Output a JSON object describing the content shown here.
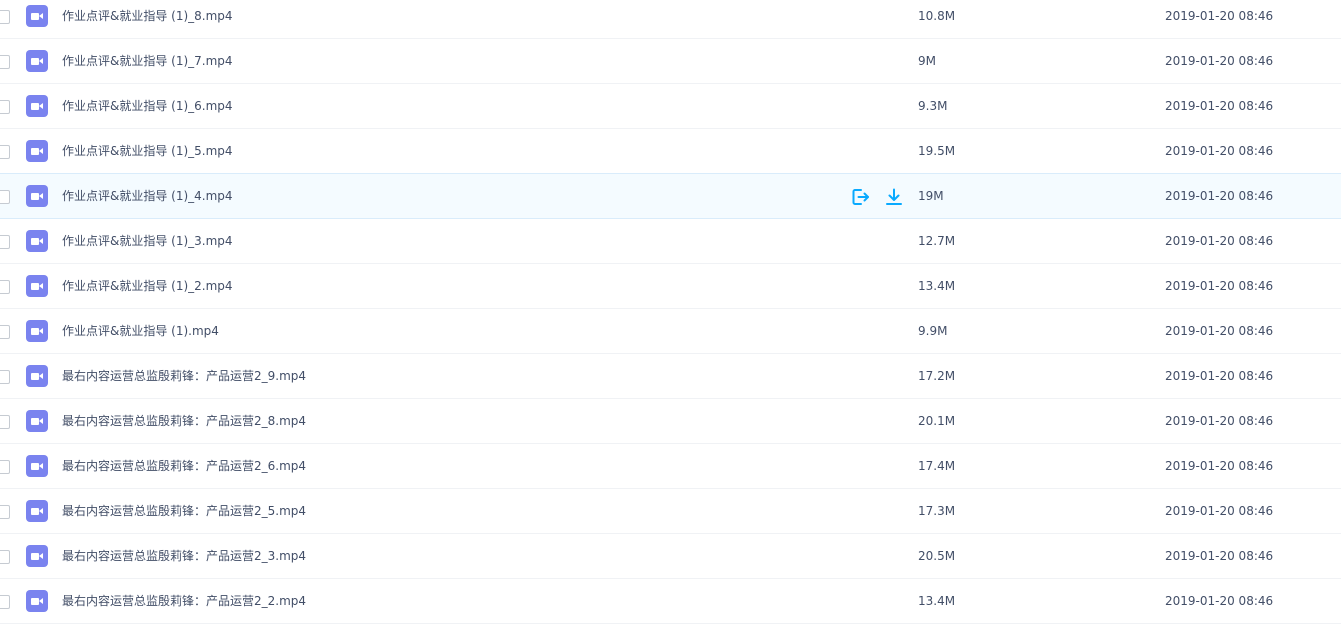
{
  "colors": {
    "video_icon": "#7a83ef",
    "action_icon": "#09aaff",
    "text": "#424e67",
    "hover_row": "#f4fbff"
  },
  "row_actions": {
    "share_icon": "share-icon",
    "download_icon": "download-icon"
  },
  "files": [
    {
      "name": "作业点评&就业指导 (1)_8.mp4",
      "size": "10.8M",
      "date": "2019-01-20 08:46",
      "icon": "video-file-icon"
    },
    {
      "name": "作业点评&就业指导 (1)_7.mp4",
      "size": "9M",
      "date": "2019-01-20 08:46",
      "icon": "video-file-icon"
    },
    {
      "name": "作业点评&就业指导 (1)_6.mp4",
      "size": "9.3M",
      "date": "2019-01-20 08:46",
      "icon": "video-file-icon"
    },
    {
      "name": "作业点评&就业指导 (1)_5.mp4",
      "size": "19.5M",
      "date": "2019-01-20 08:46",
      "icon": "video-file-icon"
    },
    {
      "name": "作业点评&就业指导 (1)_4.mp4",
      "size": "19M",
      "date": "2019-01-20 08:46",
      "icon": "video-file-icon",
      "hovered": true
    },
    {
      "name": "作业点评&就业指导 (1)_3.mp4",
      "size": "12.7M",
      "date": "2019-01-20 08:46",
      "icon": "video-file-icon"
    },
    {
      "name": "作业点评&就业指导 (1)_2.mp4",
      "size": "13.4M",
      "date": "2019-01-20 08:46",
      "icon": "video-file-icon"
    },
    {
      "name": "作业点评&就业指导 (1).mp4",
      "size": "9.9M",
      "date": "2019-01-20 08:46",
      "icon": "video-file-icon"
    },
    {
      "name": "最右内容运营总监殷莉锋：产品运营2_9.mp4",
      "size": "17.2M",
      "date": "2019-01-20 08:46",
      "icon": "video-file-icon"
    },
    {
      "name": "最右内容运营总监殷莉锋：产品运营2_8.mp4",
      "size": "20.1M",
      "date": "2019-01-20 08:46",
      "icon": "video-file-icon"
    },
    {
      "name": "最右内容运营总监殷莉锋：产品运营2_6.mp4",
      "size": "17.4M",
      "date": "2019-01-20 08:46",
      "icon": "video-file-icon"
    },
    {
      "name": "最右内容运营总监殷莉锋：产品运营2_5.mp4",
      "size": "17.3M",
      "date": "2019-01-20 08:46",
      "icon": "video-file-icon"
    },
    {
      "name": "最右内容运营总监殷莉锋：产品运营2_3.mp4",
      "size": "20.5M",
      "date": "2019-01-20 08:46",
      "icon": "video-file-icon"
    },
    {
      "name": "最右内容运营总监殷莉锋：产品运营2_2.mp4",
      "size": "13.4M",
      "date": "2019-01-20 08:46",
      "icon": "video-file-icon"
    }
  ]
}
